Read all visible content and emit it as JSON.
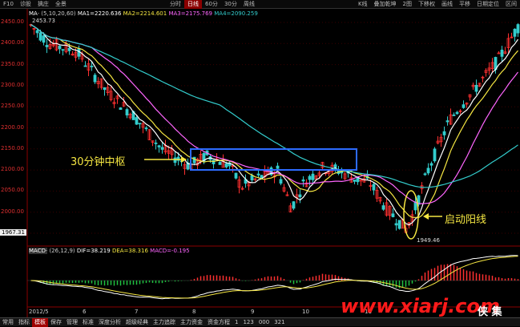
{
  "toolbar": {
    "left": [
      "F10",
      "诊股",
      "擒庄",
      "全景"
    ],
    "periods": [
      "分时",
      "日线",
      "60分",
      "30分",
      "周线"
    ],
    "selected_period": "日线",
    "right": [
      "K线",
      "叠加乾坤",
      "2图",
      "下移权",
      "画线",
      "平移",
      "日期定位",
      "区间"
    ]
  },
  "ma_line": {
    "title": "MA·",
    "params": "(5,10,20,60)",
    "ma1": "MA1=2220.636",
    "ma2": "MA2=2214.601",
    "ma3": "MA3=2175.769",
    "ma4": "MA4=2090.259"
  },
  "price_ticks": [
    "2450.00",
    "2400.00",
    "2350.00",
    "2300.00",
    "2250.00",
    "2200.00",
    "2150.00",
    "2100.00",
    "2050.00",
    "2000.00",
    "1950.00"
  ],
  "current_price": "1967.31",
  "high_label": "2453.73",
  "low_label": "1949.46",
  "annotations": {
    "left": "30分钟中枢",
    "right": "启动阳线"
  },
  "macd_line": {
    "title": "MACD·",
    "params": "(26,12,9)",
    "dif": "DIF=38.219",
    "dea": "DEA=38.316",
    "macd": "MACD=-0.195"
  },
  "date_labels": [
    "2012/5",
    "6",
    "7",
    "8",
    "9",
    "10",
    "11"
  ],
  "bottom_tabs": [
    "常用",
    "指标",
    "模板",
    "保存",
    "管理",
    "标准",
    "深度分析",
    "超级经典",
    "主力追踪",
    "主力资金",
    "资金方程",
    "1",
    "123",
    "000",
    "321"
  ],
  "selected_bottom_tab": "模板",
  "watermark": "www.xiarj.com",
  "watermark_corner": "侠 集",
  "colors": {
    "ma1": "#ffffff",
    "ma2": "#f5e642",
    "ma3": "#ff66ff",
    "ma4": "#33cccc",
    "up": "#ff3030",
    "down": "#33cccc",
    "box": "#2d6bff",
    "annotation": "#f5e642",
    "watermark": "#ff1a1a"
  }
}
